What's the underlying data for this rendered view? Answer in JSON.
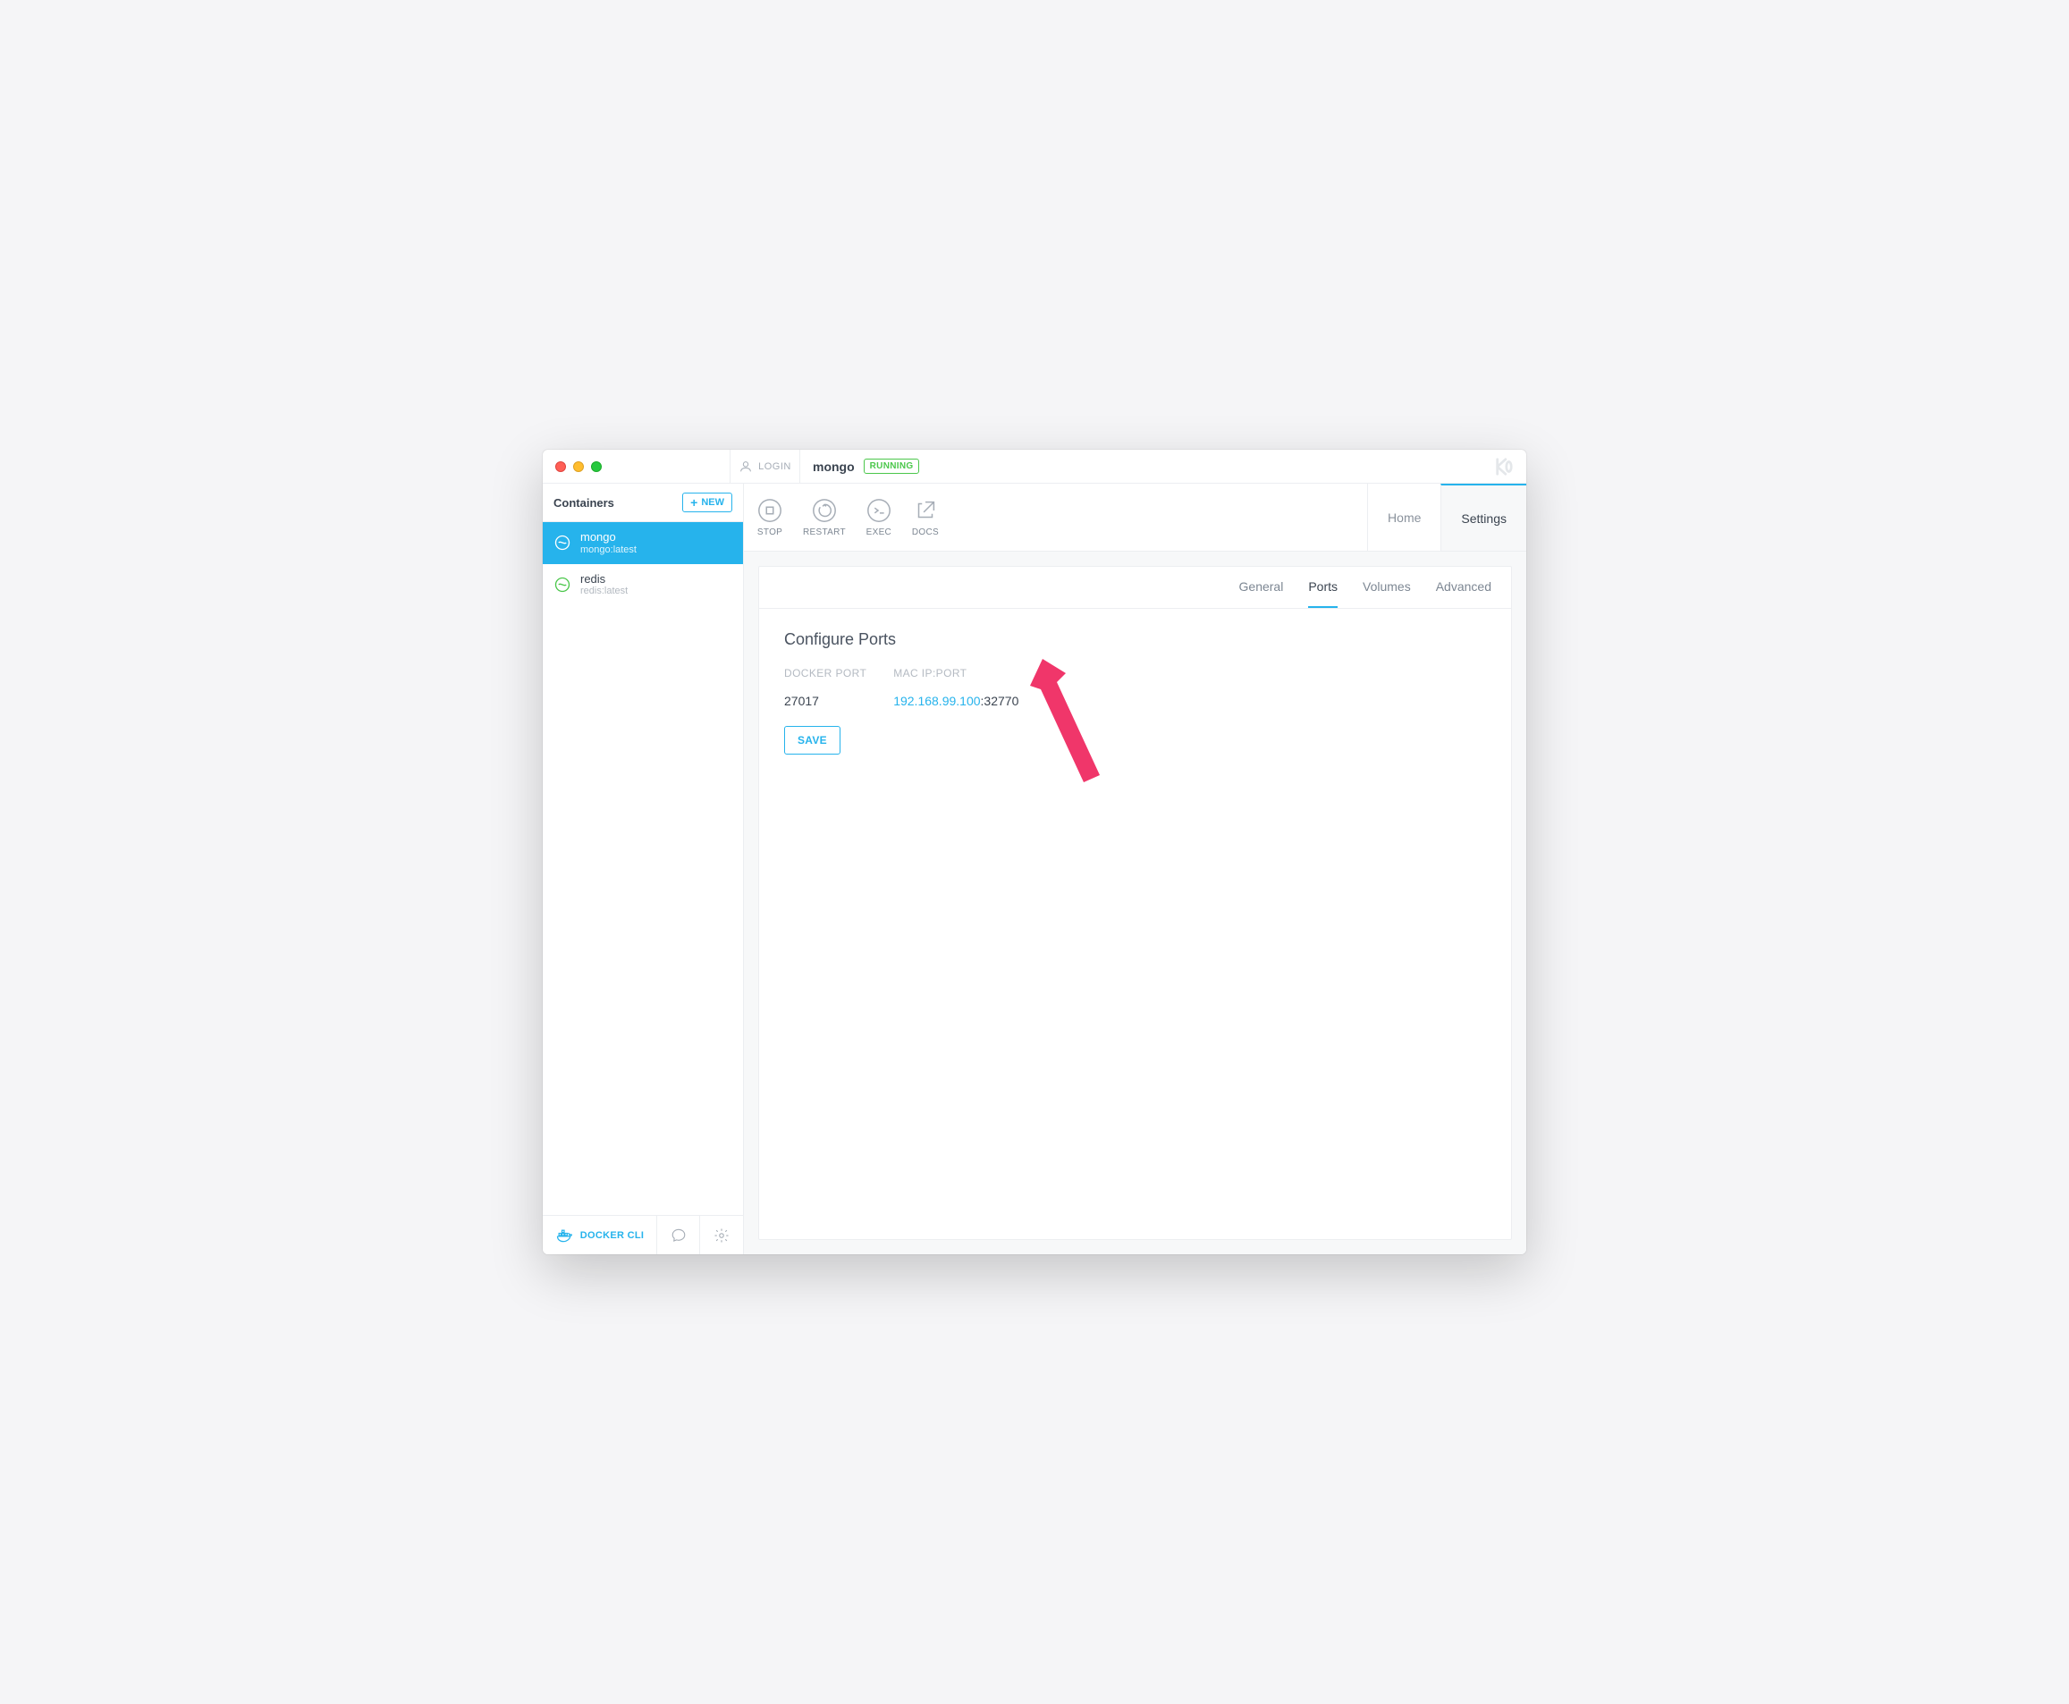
{
  "titlebar": {
    "login_label": "LOGIN",
    "container_name": "mongo",
    "status": "RUNNING",
    "brand": "K"
  },
  "sidebar": {
    "title": "Containers",
    "new_label": "NEW",
    "items": [
      {
        "name": "mongo",
        "image": "mongo:latest",
        "active": true
      },
      {
        "name": "redis",
        "image": "redis:latest",
        "active": false
      }
    ],
    "footer": {
      "cli_label": "DOCKER CLI"
    }
  },
  "toolbar": {
    "actions": {
      "stop": "STOP",
      "restart": "RESTART",
      "exec": "EXEC",
      "docs": "DOCS"
    },
    "tabs": {
      "home": "Home",
      "settings": "Settings"
    }
  },
  "settings_panel": {
    "subtabs": {
      "general": "General",
      "ports": "Ports",
      "volumes": "Volumes",
      "advanced": "Advanced"
    },
    "section_title": "Configure Ports",
    "columns": {
      "docker_port": "DOCKER PORT",
      "mac_ip_port": "MAC IP:PORT"
    },
    "rows": [
      {
        "docker_port": "27017",
        "ip": "192.168.99.100",
        "port": "32770"
      }
    ],
    "save_label": "SAVE"
  }
}
